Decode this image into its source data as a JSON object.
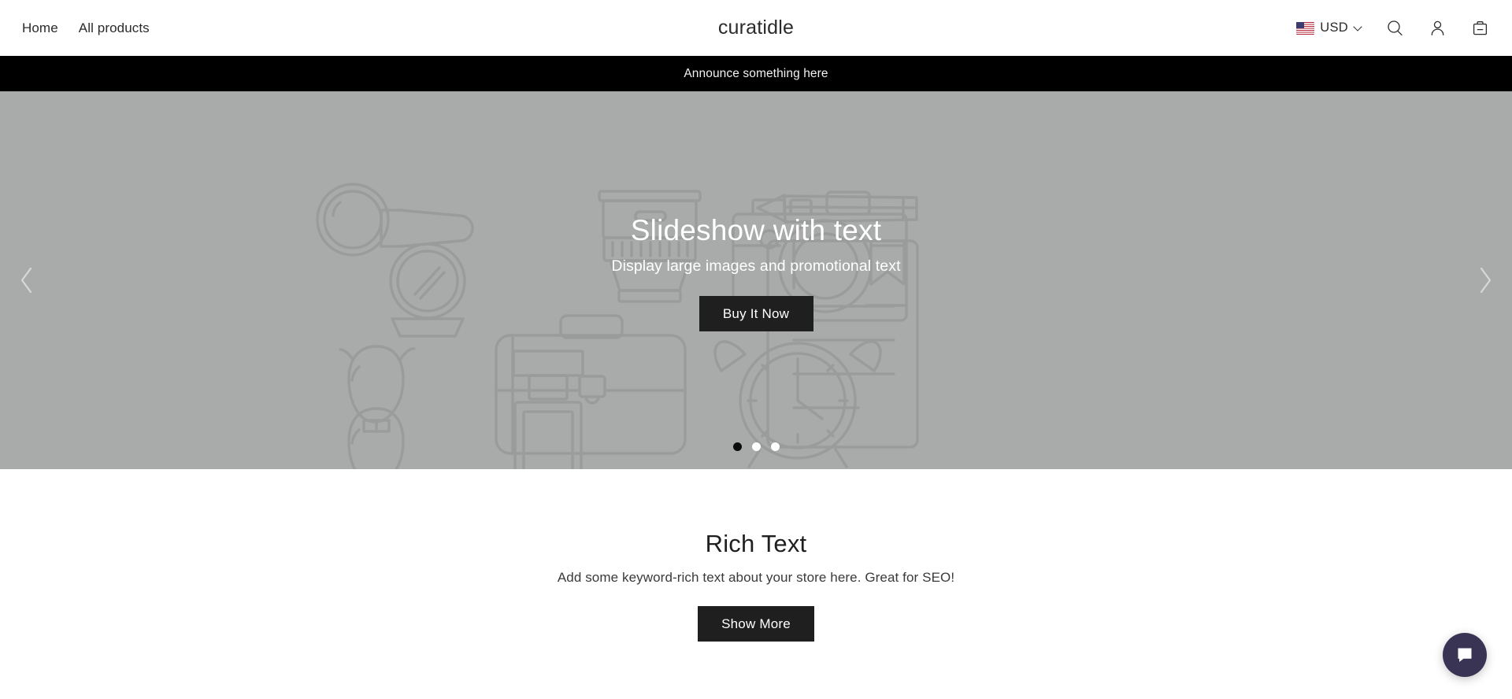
{
  "header": {
    "nav": [
      {
        "label": "Home",
        "name": "nav-link-home"
      },
      {
        "label": "All products",
        "name": "nav-link-all-products"
      }
    ],
    "brand": "curatidle",
    "currency": {
      "code": "USD",
      "flag": "us-flag-icon",
      "chevron": "chevron-down-icon"
    },
    "icons": {
      "search": "search-icon",
      "account": "account-icon",
      "cart": "cart-icon"
    }
  },
  "announcement": {
    "text": "Announce something here"
  },
  "hero": {
    "heading": "Slideshow with text",
    "subheading": "Display large images and promotional text",
    "cta_label": "Buy It Now",
    "prev_icon": "chevron-left-icon",
    "next_icon": "chevron-right-icon",
    "slides": [
      {
        "label": "1",
        "active": true
      },
      {
        "label": "2",
        "active": false
      },
      {
        "label": "3",
        "active": false
      }
    ],
    "background_color": "#a9aaaa",
    "illustration_stroke": "#9a9b9b"
  },
  "rich_text": {
    "title": "Rich Text",
    "body": "Add some keyword-rich text about your store here. Great for SEO!",
    "cta_label": "Show More"
  },
  "chat": {
    "icon": "chat-bubble-icon",
    "color": "#3a3454"
  }
}
